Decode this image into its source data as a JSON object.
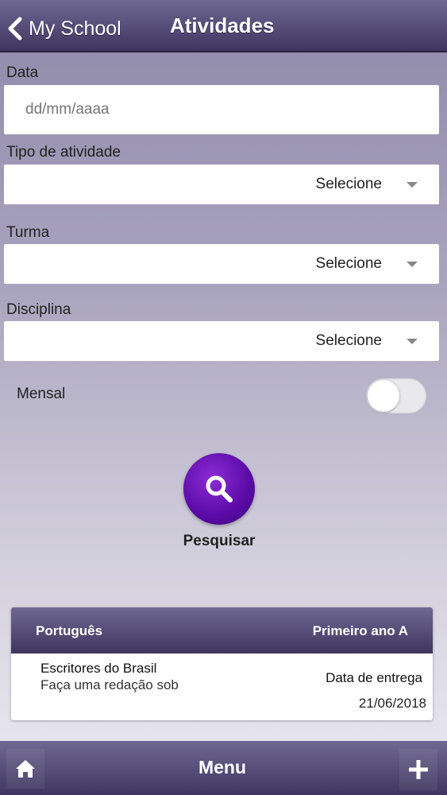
{
  "header": {
    "back_label": "My School",
    "title": "Atividades"
  },
  "form": {
    "date": {
      "label": "Data",
      "placeholder": "dd/mm/aaaa"
    },
    "activity_type": {
      "label": "Tipo de atividade",
      "value": "Selecione"
    },
    "class": {
      "label": "Turma",
      "value": "Selecione"
    },
    "subject": {
      "label": "Disciplina",
      "value": "Selecione"
    },
    "monthly": {
      "label": "Mensal",
      "on": false
    }
  },
  "search": {
    "label": "Pesquisar"
  },
  "activities": [
    {
      "subject": "Português",
      "class": "Primeiro ano A",
      "title": "Escritores do Brasil",
      "description": "Faça uma redação sob",
      "due_label": "Data de entrega",
      "due_date": "21/06/2018"
    }
  ],
  "footer": {
    "menu_label": "Menu"
  },
  "colors": {
    "header": "#3e365f",
    "accent": "#5a0aa6"
  },
  "icons": [
    "chevron-left-icon",
    "caret-down-icon",
    "search-icon",
    "home-icon",
    "plus-icon"
  ]
}
